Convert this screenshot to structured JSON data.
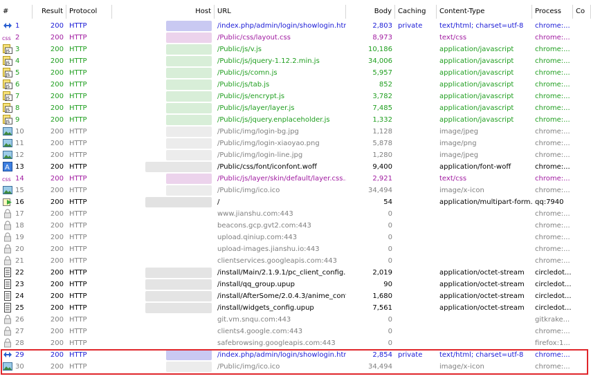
{
  "colors": {
    "blue": "#1a1ad6",
    "purple": "#a01aa0",
    "green": "#1e9e1e",
    "gray": "#808080",
    "black": "#000000",
    "highlight_border": "#e0262b"
  },
  "columns": [
    {
      "key": "num",
      "label": "#"
    },
    {
      "key": "result",
      "label": "Result"
    },
    {
      "key": "protocol",
      "label": "Protocol"
    },
    {
      "key": "host",
      "label": "Host"
    },
    {
      "key": "url",
      "label": "URL"
    },
    {
      "key": "body",
      "label": "Body"
    },
    {
      "key": "caching",
      "label": "Caching"
    },
    {
      "key": "ctype",
      "label": "Content-Type"
    },
    {
      "key": "process",
      "label": "Process"
    },
    {
      "key": "comments",
      "label": "Co"
    }
  ],
  "rows": [
    {
      "num": "1",
      "icon": "arrows-icon",
      "result": "200",
      "protocol": "HTTP",
      "host": "",
      "url": "/index.php/admin/login/showlogin.html",
      "body": "2,803",
      "caching": "private",
      "ctype": "text/html; charset=utf-8",
      "process": "chrome:...",
      "color": "blue",
      "host_blur": "#c9c9f2"
    },
    {
      "num": "2",
      "icon": "css-icon",
      "result": "200",
      "protocol": "HTTP",
      "host": "",
      "url": "/Public/css/layout.css",
      "body": "8,973",
      "caching": "",
      "ctype": "text/css",
      "process": "chrome:...",
      "color": "purple",
      "host_blur": "#ecd3ec"
    },
    {
      "num": "3",
      "icon": "js-icon",
      "result": "200",
      "protocol": "HTTP",
      "host": "",
      "url": "/Public/js/v.js",
      "body": "10,186",
      "caching": "",
      "ctype": "application/javascript",
      "process": "chrome:...",
      "color": "green",
      "host_blur": "#d8eed8"
    },
    {
      "num": "4",
      "icon": "js-icon",
      "result": "200",
      "protocol": "HTTP",
      "host": "",
      "url": "/Public/js/jquery-1.12.2.min.js",
      "body": "34,006",
      "caching": "",
      "ctype": "application/javascript",
      "process": "chrome:...",
      "color": "green",
      "host_blur": "#d8eed8"
    },
    {
      "num": "5",
      "icon": "js-icon",
      "result": "200",
      "protocol": "HTTP",
      "host": "",
      "url": "/Public/js/comn.js",
      "body": "5,957",
      "caching": "",
      "ctype": "application/javascript",
      "process": "chrome:...",
      "color": "green",
      "host_blur": "#d8eed8"
    },
    {
      "num": "6",
      "icon": "js-icon",
      "result": "200",
      "protocol": "HTTP",
      "host": "",
      "url": "/Public/js/tab.js",
      "body": "852",
      "caching": "",
      "ctype": "application/javascript",
      "process": "chrome:...",
      "color": "green",
      "host_blur": "#d8eed8"
    },
    {
      "num": "7",
      "icon": "js-icon",
      "result": "200",
      "protocol": "HTTP",
      "host": "",
      "url": "/Public/js/encrypt.js",
      "body": "3,782",
      "caching": "",
      "ctype": "application/javascript",
      "process": "chrome:...",
      "color": "green",
      "host_blur": "#d8eed8"
    },
    {
      "num": "8",
      "icon": "js-icon",
      "result": "200",
      "protocol": "HTTP",
      "host": "",
      "url": "/Public/js/layer/layer.js",
      "body": "7,485",
      "caching": "",
      "ctype": "application/javascript",
      "process": "chrome:...",
      "color": "green",
      "host_blur": "#d8eed8"
    },
    {
      "num": "9",
      "icon": "js-icon",
      "result": "200",
      "protocol": "HTTP",
      "host": "",
      "url": "/Public/js/jquery.enplaceholder.js",
      "body": "1,332",
      "caching": "",
      "ctype": "application/javascript",
      "process": "chrome:...",
      "color": "green",
      "host_blur": "#d8eed8"
    },
    {
      "num": "10",
      "icon": "image-icon",
      "result": "200",
      "protocol": "HTTP",
      "host": "",
      "url": "/Public/img/login-bg.jpg",
      "body": "1,128",
      "caching": "",
      "ctype": "image/jpeg",
      "process": "chrome:...",
      "color": "gray",
      "host_blur": "#ececec"
    },
    {
      "num": "11",
      "icon": "image-icon",
      "result": "200",
      "protocol": "HTTP",
      "host": "",
      "url": "/Public/img/login-xiaoyao.png",
      "body": "5,878",
      "caching": "",
      "ctype": "image/png",
      "process": "chrome:...",
      "color": "gray",
      "host_blur": "#ececec"
    },
    {
      "num": "12",
      "icon": "image-icon",
      "result": "200",
      "protocol": "HTTP",
      "host": "",
      "url": "/Public/img/login-line.jpg",
      "body": "1,280",
      "caching": "",
      "ctype": "image/jpeg",
      "process": "chrome:...",
      "color": "gray",
      "host_blur": "#ececec"
    },
    {
      "num": "13",
      "icon": "font-icon",
      "result": "200",
      "protocol": "HTTP",
      "host": "",
      "url": "/Public/css/font/iconfont.woff",
      "body": "9,400",
      "caching": "",
      "ctype": "application/font-woff",
      "process": "chrome:...",
      "color": "black",
      "host_blur": "#e6e6e6"
    },
    {
      "num": "14",
      "icon": "css-icon",
      "result": "200",
      "protocol": "HTTP",
      "host": "",
      "url": "/Public/js/layer/skin/default/layer.css...",
      "body": "2,921",
      "caching": "",
      "ctype": "text/css",
      "process": "chrome:...",
      "color": "purple",
      "host_blur": "#ecd3ec"
    },
    {
      "num": "15",
      "icon": "image-icon",
      "result": "200",
      "protocol": "HTTP",
      "host": "",
      "url": "/Public/img/ico.ico",
      "body": "34,494",
      "caching": "",
      "ctype": "image/x-icon",
      "process": "chrome:...",
      "color": "gray",
      "host_blur": "#ececec"
    },
    {
      "num": "16",
      "icon": "post-icon",
      "result": "200",
      "protocol": "HTTP",
      "host": "",
      "url": "/",
      "body": "54",
      "caching": "",
      "ctype": "application/multipart-form...",
      "process": "qq:7940",
      "color": "black",
      "host_blur": "#e2e2e2"
    },
    {
      "num": "17",
      "icon": "lock-icon",
      "result": "200",
      "protocol": "HTTP",
      "host": "",
      "url": "www.jianshu.com:443",
      "body": "0",
      "caching": "",
      "ctype": "",
      "process": "chrome:...",
      "color": "gray",
      "host_blur": ""
    },
    {
      "num": "18",
      "icon": "lock-icon",
      "result": "200",
      "protocol": "HTTP",
      "host": "",
      "url": "beacons.gcp.gvt2.com:443",
      "body": "0",
      "caching": "",
      "ctype": "",
      "process": "chrome:...",
      "color": "gray",
      "host_blur": ""
    },
    {
      "num": "19",
      "icon": "lock-icon",
      "result": "200",
      "protocol": "HTTP",
      "host": "",
      "url": "upload.qiniup.com:443",
      "body": "0",
      "caching": "",
      "ctype": "",
      "process": "chrome:...",
      "color": "gray",
      "host_blur": ""
    },
    {
      "num": "20",
      "icon": "lock-icon",
      "result": "200",
      "protocol": "HTTP",
      "host": "",
      "url": "upload-images.jianshu.io:443",
      "body": "0",
      "caching": "",
      "ctype": "",
      "process": "chrome:...",
      "color": "gray",
      "host_blur": ""
    },
    {
      "num": "21",
      "icon": "lock-icon",
      "result": "200",
      "protocol": "HTTP",
      "host": "",
      "url": "clientservices.googleapis.com:443",
      "body": "0",
      "caching": "",
      "ctype": "",
      "process": "chrome:...",
      "color": "gray",
      "host_blur": ""
    },
    {
      "num": "22",
      "icon": "document-icon",
      "result": "200",
      "protocol": "HTTP",
      "host": "",
      "url": "/install/Main/2.1.9.1/pc_client_config...",
      "body": "2,019",
      "caching": "",
      "ctype": "application/octet-stream",
      "process": "circledot...",
      "color": "black",
      "host_blur": "#e4e4e4"
    },
    {
      "num": "23",
      "icon": "document-icon",
      "result": "200",
      "protocol": "HTTP",
      "host": "",
      "url": "/install/qq_group.upup",
      "body": "90",
      "caching": "",
      "ctype": "application/octet-stream",
      "process": "circledot...",
      "color": "black",
      "host_blur": "#e4e4e4"
    },
    {
      "num": "24",
      "icon": "document-icon",
      "result": "200",
      "protocol": "HTTP",
      "host": "",
      "url": "/install/AfterSome/2.0.4.3/anime_confi...",
      "body": "1,680",
      "caching": "",
      "ctype": "application/octet-stream",
      "process": "circledot...",
      "color": "black",
      "host_blur": "#e4e4e4"
    },
    {
      "num": "25",
      "icon": "document-icon",
      "result": "200",
      "protocol": "HTTP",
      "host": "",
      "url": "/install/widgets_config.upup",
      "body": "7,561",
      "caching": "",
      "ctype": "application/octet-stream",
      "process": "circledot...",
      "color": "black",
      "host_blur": "#e4e4e4"
    },
    {
      "num": "26",
      "icon": "lock-icon",
      "result": "200",
      "protocol": "HTTP",
      "host": "",
      "url": "git.vm.snqu.com:443",
      "body": "0",
      "caching": "",
      "ctype": "",
      "process": "gitkrake...",
      "color": "gray",
      "host_blur": ""
    },
    {
      "num": "27",
      "icon": "lock-icon",
      "result": "200",
      "protocol": "HTTP",
      "host": "",
      "url": "clients4.google.com:443",
      "body": "0",
      "caching": "",
      "ctype": "",
      "process": "chrome:...",
      "color": "gray",
      "host_blur": ""
    },
    {
      "num": "28",
      "icon": "lock-icon",
      "result": "200",
      "protocol": "HTTP",
      "host": "",
      "url": "safebrowsing.googleapis.com:443",
      "body": "0",
      "caching": "",
      "ctype": "",
      "process": "firefox:1...",
      "color": "gray",
      "host_blur": ""
    },
    {
      "num": "29",
      "icon": "arrows-icon",
      "result": "200",
      "protocol": "HTTP",
      "host": "",
      "url": "/index.php/admin/login/showlogin.html",
      "body": "2,854",
      "caching": "private",
      "ctype": "text/html; charset=utf-8",
      "process": "chrome:...",
      "color": "blue",
      "host_blur": "#c9c9f2"
    },
    {
      "num": "30",
      "icon": "image-icon",
      "result": "200",
      "protocol": "HTTP",
      "host": "",
      "url": "/Public/img/ico.ico",
      "body": "34,494",
      "caching": "",
      "ctype": "image/x-icon",
      "process": "chrome:...",
      "color": "gray",
      "host_blur": "#ececec"
    }
  ]
}
